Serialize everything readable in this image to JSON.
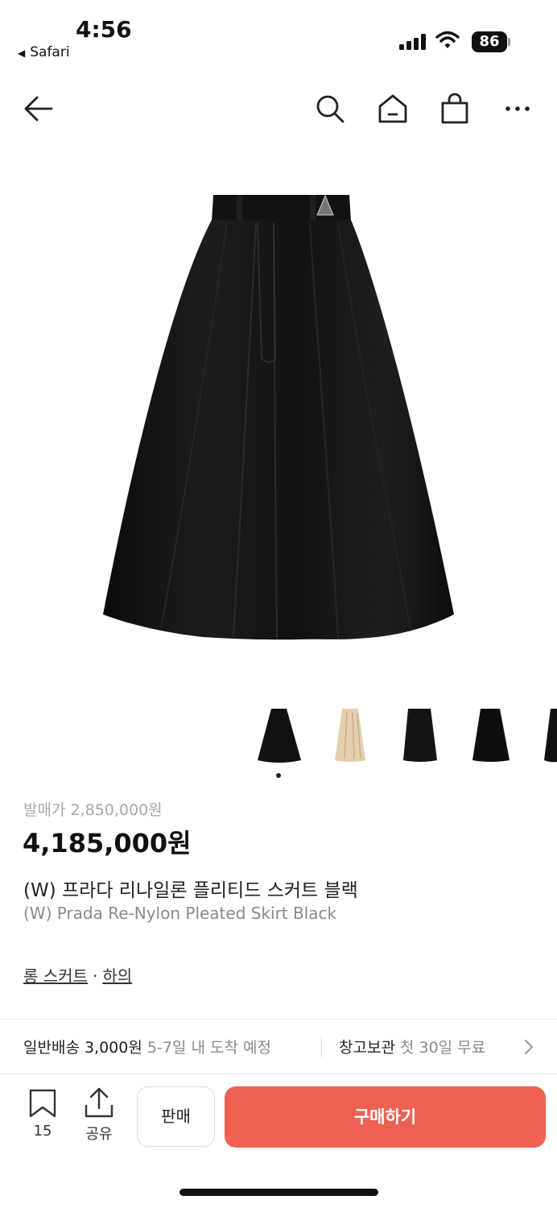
{
  "status": {
    "time": "4:56",
    "back_app": "Safari",
    "battery": "86"
  },
  "nav": {
    "back": "back-arrow-icon",
    "search": "search-icon",
    "home": "home-icon",
    "cart": "shopping-bag-icon",
    "more": "more-icon"
  },
  "product": {
    "release_price": "발매가 2,850,000원",
    "price": "4,185,000원",
    "name_ko": "(W) 프라다 리나일론 플리티드 스커트 블랙",
    "name_en": "(W) Prada Re-Nylon Pleated Skirt Black",
    "category_1": "롱 스커트",
    "category_sep": "·",
    "category_2": "하의"
  },
  "thumbnails": [
    "black-skirt-front",
    "beige-pleated-skirt",
    "black-skirt-side",
    "black-skirt-back",
    "black-skirt-partial"
  ],
  "shipping": {
    "label": "일반배송",
    "fee": "3,000원",
    "eta": "5-7일 내 도착 예정",
    "storage_label": "창고보관",
    "storage_note": "첫 30일 무료"
  },
  "bottom": {
    "bookmark_count": "15",
    "share_label": "공유",
    "sell_label": "판매",
    "buy_label": "구매하기"
  },
  "colors": {
    "accent": "#ee6153",
    "text": "#222222",
    "muted": "#8a8a8a"
  }
}
